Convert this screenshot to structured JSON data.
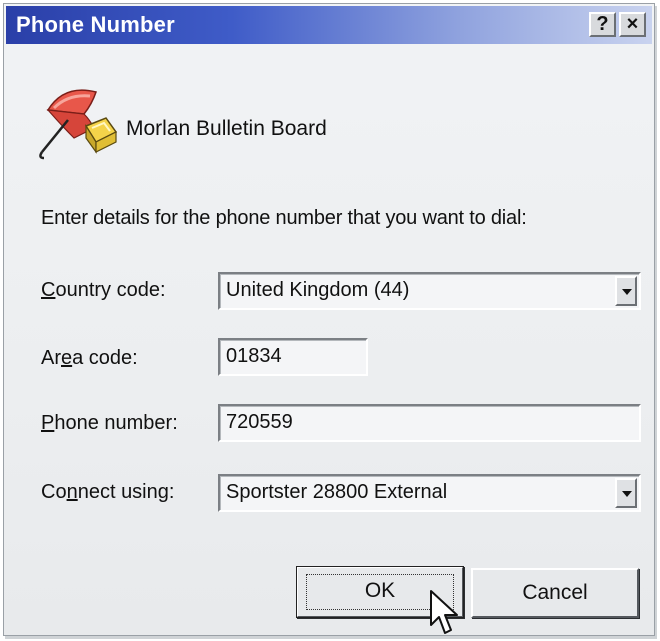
{
  "window": {
    "title": "Phone Number",
    "help_label": "?",
    "close_label": "×"
  },
  "app": {
    "name": "Morlan Bulletin Board",
    "icon": "umbrella-icon"
  },
  "prompt": "Enter details for the phone number that you want to dial:",
  "fields": {
    "country": {
      "label_pre": "",
      "label_key": "C",
      "label_post": "ountry code:",
      "value": "United Kingdom (44)"
    },
    "area": {
      "label_pre": "Ar",
      "label_key": "e",
      "label_post": "a code:",
      "value": "01834"
    },
    "phone": {
      "label_pre": "",
      "label_key": "P",
      "label_post": "hone number:",
      "value": "720559"
    },
    "connect": {
      "label_pre": "Co",
      "label_key": "n",
      "label_post": "nect using:",
      "value": "Sportster 28800 External"
    }
  },
  "buttons": {
    "ok": "OK",
    "cancel": "Cancel"
  },
  "colors": {
    "title_bar_start": "#2a3fa8",
    "title_bar_end": "#c9d3ef"
  }
}
